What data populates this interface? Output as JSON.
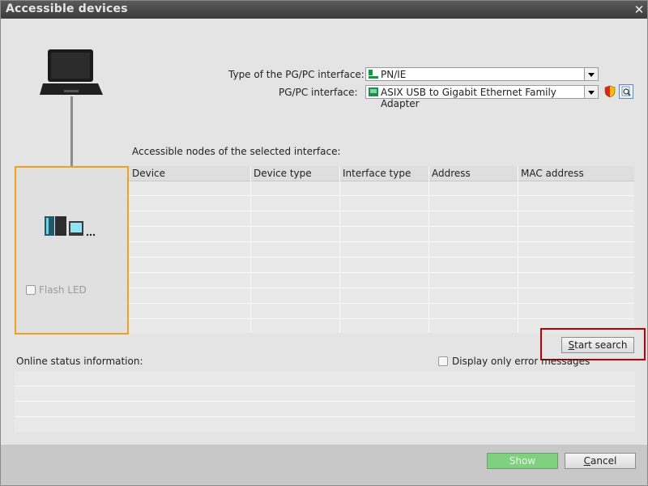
{
  "window": {
    "title": "Accessible devices"
  },
  "interface": {
    "type_label": "Type of the PG/PC interface:",
    "type_value": "PN/IE",
    "pgpc_label": "PG/PC interface:",
    "pgpc_value": "ASIX USB to Gigabit Ethernet Family Adapter"
  },
  "nodes": {
    "heading": "Accessible nodes of the selected interface:",
    "columns": [
      "Device",
      "Device type",
      "Interface type",
      "Address",
      "MAC address"
    ],
    "rows": []
  },
  "flash_led": {
    "label": "Flash LED",
    "checked": false
  },
  "buttons": {
    "start_search_prefix": "S",
    "start_search_rest": "tart search",
    "show": "Show",
    "cancel_prefix": "C",
    "cancel_rest": "ancel"
  },
  "status": {
    "heading": "Online status information:",
    "display_errors_label": "Display only error messages"
  },
  "colors": {
    "highlight_orange": "#f0a020",
    "highlight_red": "#c00000",
    "show_button": "#7fd07f"
  }
}
